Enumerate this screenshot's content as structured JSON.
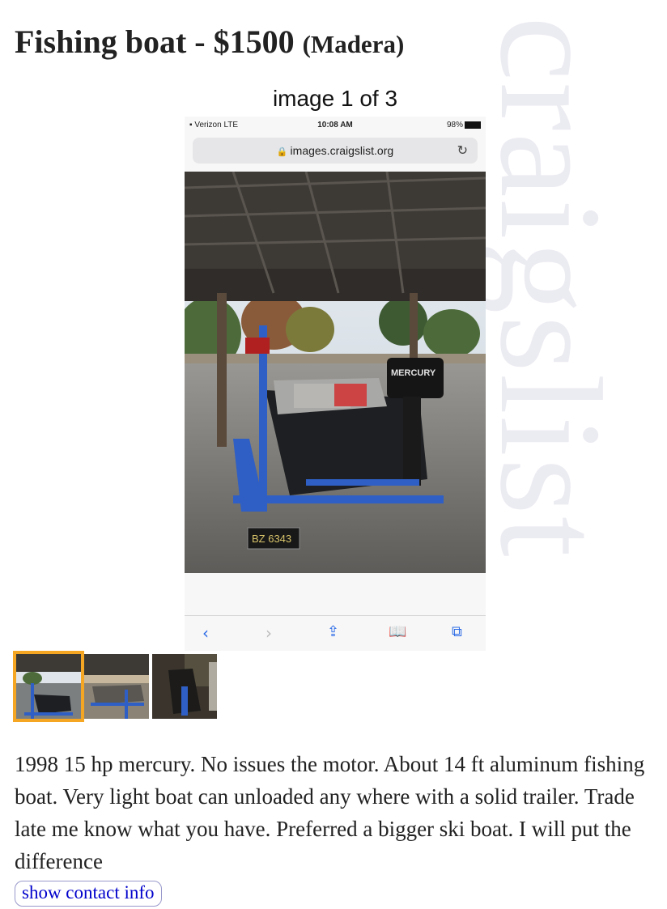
{
  "posting": {
    "title": "Fishing boat - $1500",
    "location": "(Madera)",
    "watermark": "craigslist",
    "description": "1998 15 hp mercury. No issues the motor. About 14 ft aluminum fishing boat. Very light boat can unloaded any where with a solid trailer. Trade late me know what you have. Preferred a bigger ski boat. I will put the difference",
    "contact_button": "show contact info"
  },
  "gallery": {
    "counter": "image 1 of 3",
    "active_index": 0,
    "thumbnail_count": 3
  },
  "photo_screenshot": {
    "carrier": "Verizon  LTE",
    "time": "10:08 AM",
    "battery": "98%",
    "url": "images.craigslist.org",
    "motor_brand": "MERCURY",
    "plate": "BZ 6343"
  },
  "colors": {
    "active_thumb_border": "#f5a623",
    "link": "#0000cc",
    "watermark": "#ebebf2",
    "safari_blue": "#2a6ae6",
    "trailer": "#2f5fc4"
  }
}
